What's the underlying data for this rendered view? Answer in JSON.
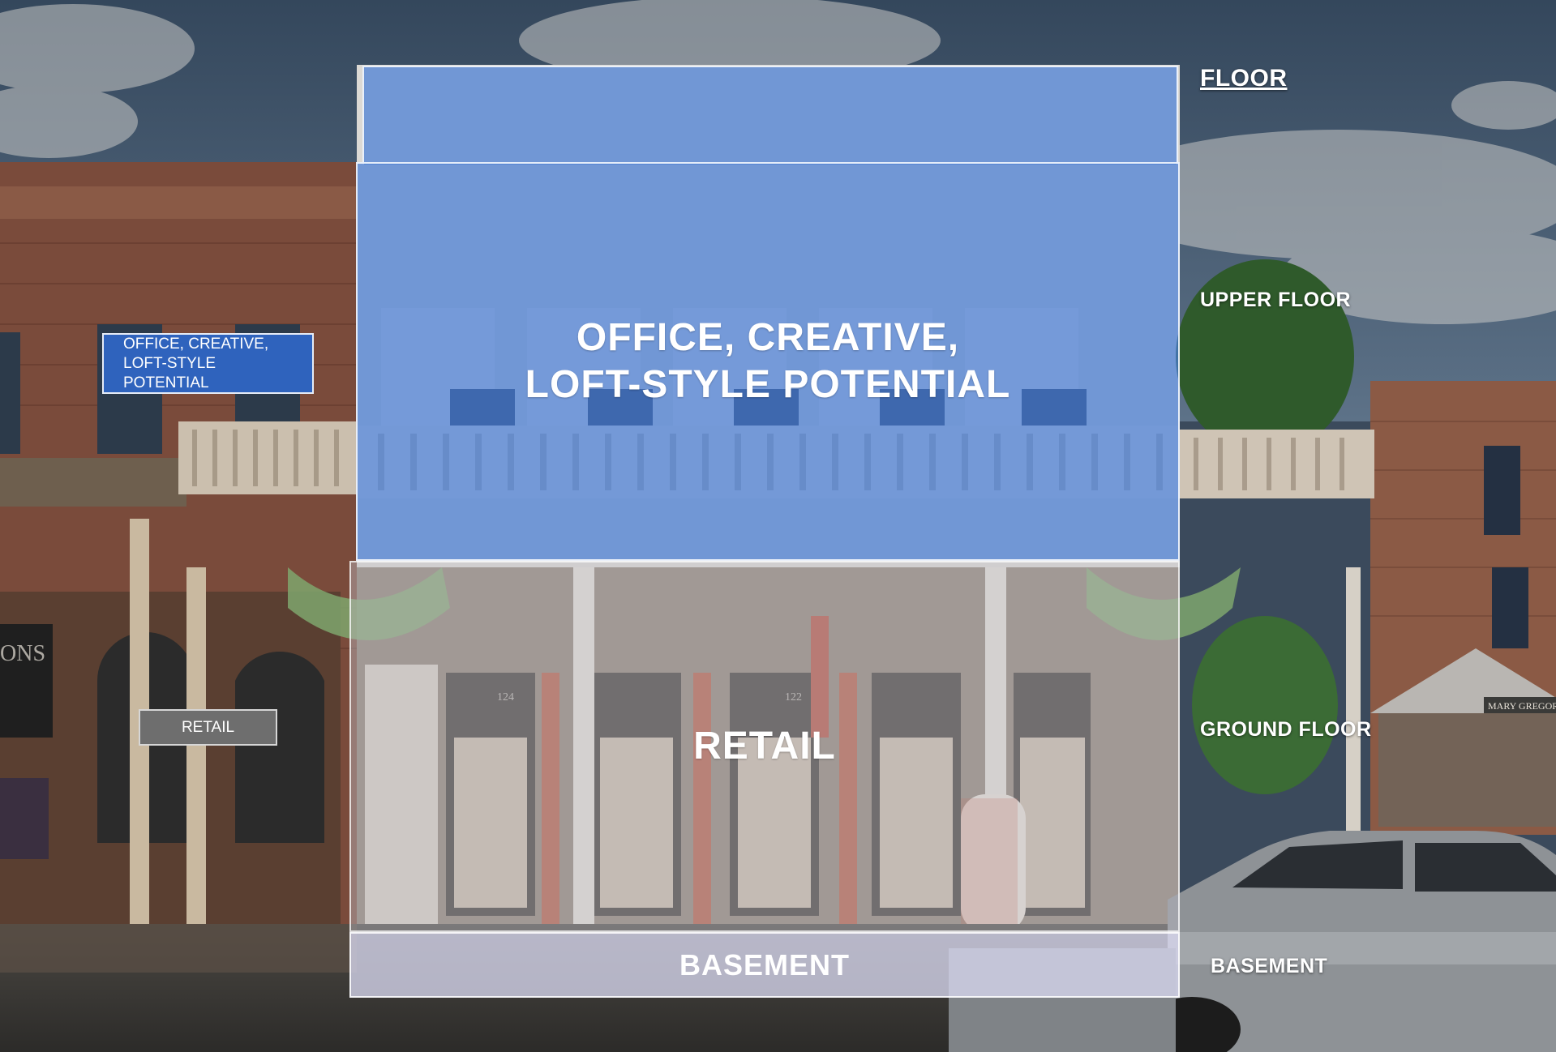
{
  "header": {
    "floor_label": "FLOOR"
  },
  "floors": {
    "upper": {
      "side_label": "UPPER FLOOR",
      "overlay_text": "OFFICE, CREATIVE,\nLOFT-STYLE POTENTIAL"
    },
    "ground": {
      "side_label": "GROUND FLOOR",
      "overlay_text": "RETAIL"
    },
    "basement": {
      "side_label": "BASEMENT",
      "overlay_text": "BASEMENT"
    }
  },
  "legend": {
    "office_tag": "OFFICE, CREATIVE,\nLOFT-STYLE POTENTIAL",
    "retail_tag": "RETAIL"
  },
  "photo_signage": {
    "address_1": "124",
    "address_2": "122",
    "left_sign": "ONS",
    "right_sign": "MARY GREGORY"
  },
  "colors": {
    "office_overlay": "#487dd6",
    "retail_overlay": "#bebec8",
    "basement_overlay": "#d7d7ee",
    "office_tag": "#2f63bd",
    "retail_tag": "#6e6e6e"
  }
}
